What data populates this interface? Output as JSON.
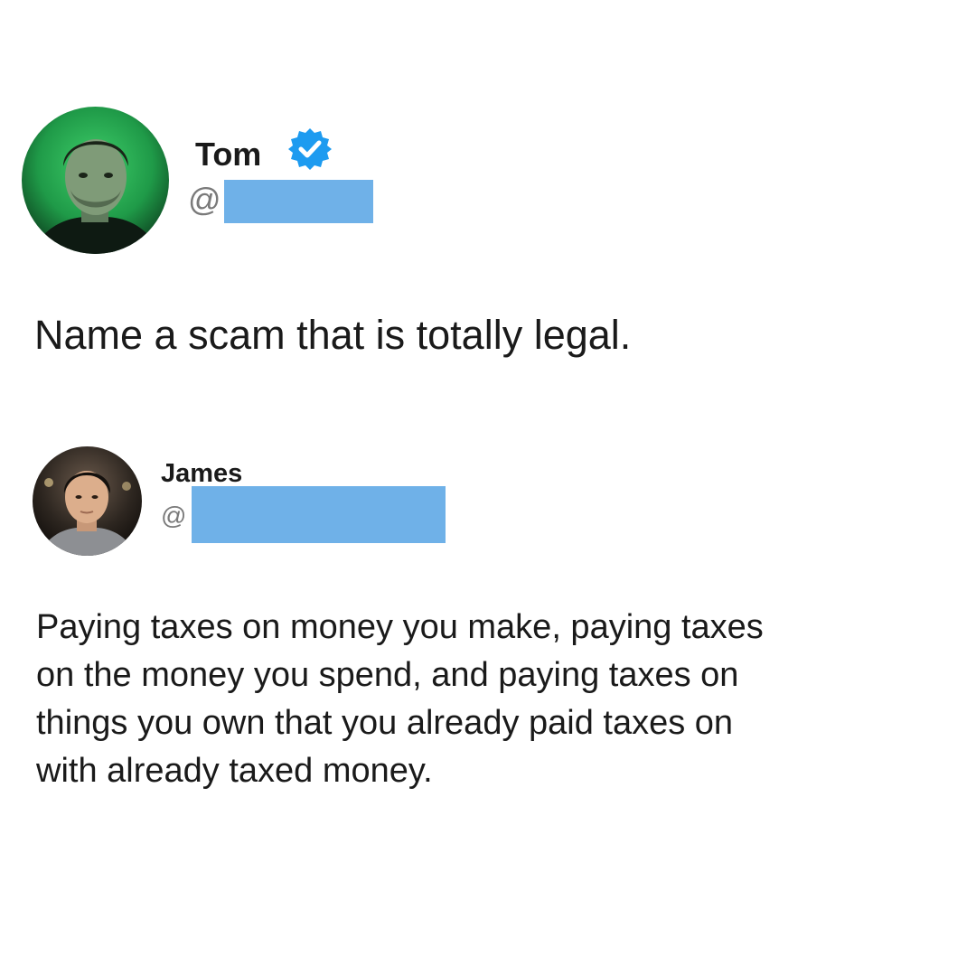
{
  "original_post": {
    "author_name": "Tom",
    "handle_prefix": "@",
    "verified": true,
    "text": "Name a scam that is totally legal."
  },
  "reply": {
    "author_name": "James",
    "handle_prefix": "@",
    "verified": false,
    "text": "Paying taxes on money you make, paying taxes\non the money you spend, and paying taxes on\nthings you own that you already paid taxes on\nwith already taxed money."
  },
  "colors": {
    "redaction": "#6fb1e8",
    "verified_badge": "#1d9bf0",
    "text": "#1a1a1a",
    "handle": "#7a7a7a"
  },
  "icons": {
    "verified": "verified-badge-icon"
  }
}
